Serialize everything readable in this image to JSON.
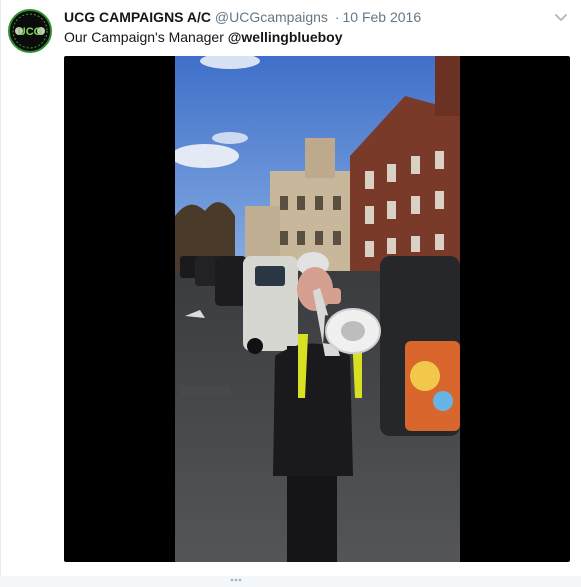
{
  "tweet": {
    "display_name": "UCG CAMPAIGNS A/C",
    "handle": "@UCGcampaigns",
    "separator": "·",
    "date": "10 Feb 2016",
    "text_prefix": "Our Campaign's Manager",
    "mention": "@wellingblueboy"
  },
  "avatar": {
    "logo_text": "UCG",
    "colors": {
      "ring": "#2f8f2f",
      "fill": "#0b0b0b",
      "text": "#7ed957"
    }
  },
  "media": {
    "type": "video",
    "icons": [
      "chevron-down-icon"
    ]
  },
  "colors": {
    "name": "#14171a",
    "meta": "#657786",
    "border": "#e6ecf0"
  }
}
